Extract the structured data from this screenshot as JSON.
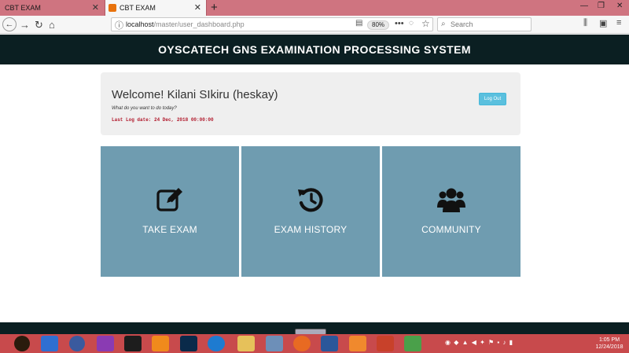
{
  "browser": {
    "tabs": [
      {
        "title": "CBT EXAM",
        "active": false
      },
      {
        "title": "CBT EXAM",
        "active": true
      }
    ],
    "url_host": "localhost",
    "url_path": "/master/user_dashboard.php",
    "zoom": "80%",
    "search_placeholder": "Search"
  },
  "page": {
    "header_title": "OYSCATECH GNS EXAMINATION PROCESSING SYSTEM",
    "welcome": {
      "greeting": "Welcome! Kilani SIkiru (heskay)",
      "prompt": "What do you want to do today?",
      "last_log": "Last Log date: 24 Dec, 2018 00:00:00",
      "logout_label": "Log Out"
    },
    "tiles": [
      {
        "label": "TAKE EXAM",
        "icon": "edit-icon"
      },
      {
        "label": "EXAM HISTORY",
        "icon": "history-icon"
      },
      {
        "label": "COMMUNITY",
        "icon": "users-icon"
      }
    ]
  },
  "taskbar": {
    "time": "1:05 PM",
    "date": "12/24/2018"
  },
  "colors": {
    "tab_strip": "#cf7480",
    "header_bg": "#0b1f22",
    "tile_bg": "#6f9cb0",
    "logout_btn": "#5bc0de",
    "last_log_text": "#b1182b",
    "taskbar": "#c84a4c"
  }
}
